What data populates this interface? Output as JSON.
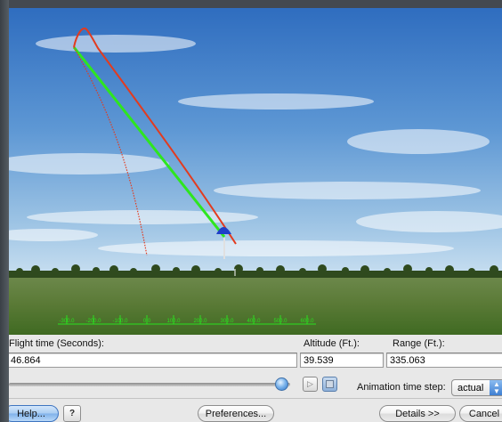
{
  "scene": {
    "ruler_ticks": [
      "-300.0",
      "-200.0",
      "-100.0",
      "0.0",
      "100.0",
      "200.0",
      "300.0",
      "400.0",
      "500.0",
      "600.0"
    ],
    "colors": {
      "sky_top": "#3a76c4",
      "sky_bottom": "#b9d7ea",
      "ground": "#5c7a3a",
      "flight_path": "#e23b1f",
      "projection_path": "#2ee61f",
      "ruler": "#29e21f",
      "parachute": "#1f3fc8"
    }
  },
  "readouts": {
    "flight_time_label": "Flight time (Seconds):",
    "flight_time_value": "46.864",
    "altitude_label": "Altitude (Ft.):",
    "altitude_value": "39.539",
    "range_label": "Range (Ft.):",
    "range_value": "335.063"
  },
  "playback": {
    "slider_position": 0.97,
    "play_icon": "play-icon",
    "stop_icon": "stop-icon",
    "anim_step_label": "Animation time step:",
    "anim_step_value": "actual"
  },
  "buttons": {
    "help": "Help...",
    "help_icon": "context-help-icon",
    "preferences": "Preferences...",
    "details": "Details >>",
    "cancel": "Cancel"
  }
}
